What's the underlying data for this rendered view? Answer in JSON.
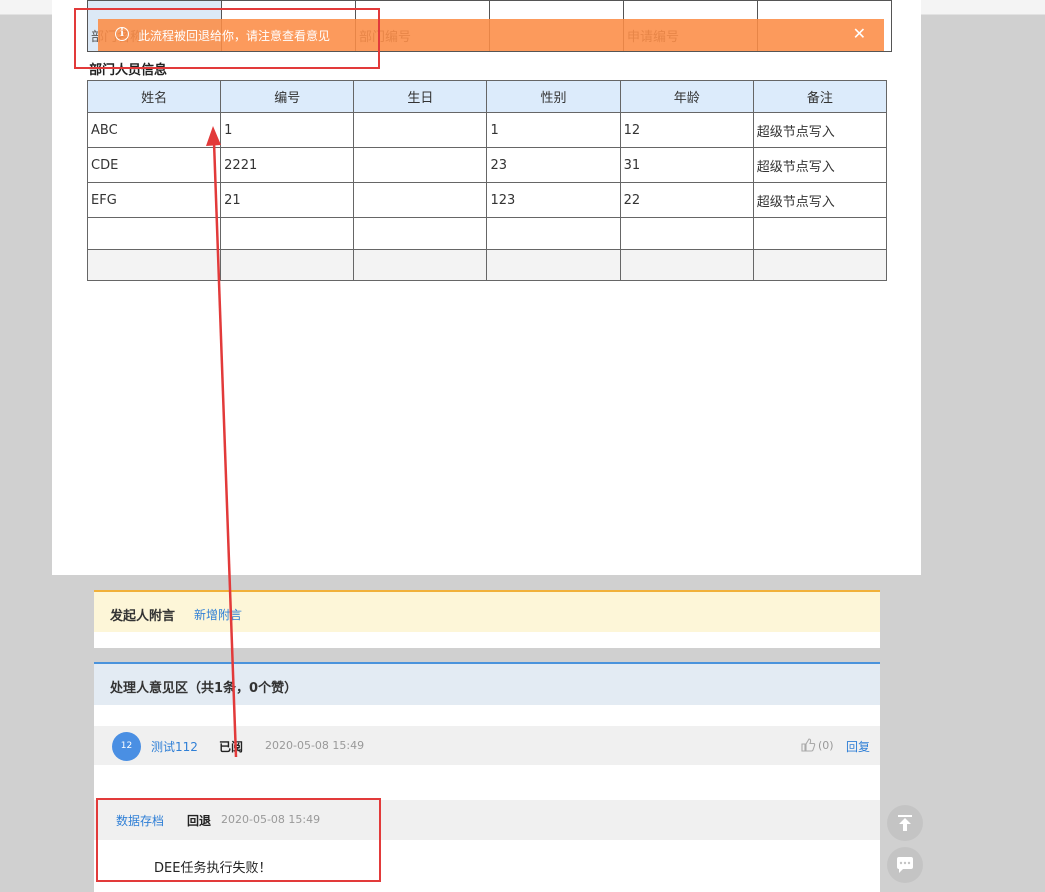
{
  "form": {
    "dept_row": {
      "dept_name_label": "部门名称",
      "dept_code_label": "部门编号",
      "apply_code_label": "申请编号"
    },
    "members_title": "部门人员信息",
    "columns": [
      "姓名",
      "编号",
      "生日",
      "性别",
      "年龄",
      "备注"
    ],
    "rows": [
      [
        "ABC",
        "1",
        "",
        "1",
        "12",
        "超级节点写入"
      ],
      [
        "CDE",
        "2221",
        "",
        "23",
        "31",
        "超级节点写入"
      ],
      [
        "EFG",
        "21",
        "",
        "123",
        "22",
        "超级节点写入"
      ]
    ]
  },
  "alert": {
    "icon": "info-icon",
    "icon_glyph": "i",
    "message": "此流程被回退给你，请注意查看意见",
    "close_glyph": "✕"
  },
  "attachment": {
    "title": "发起人附言",
    "add_link": "新增附言"
  },
  "opinions": {
    "title": "处理人意见区（共1条，0个赞）",
    "items": [
      {
        "avatar_text": "12",
        "user": "测试112",
        "action": "已阅",
        "time": "2020-05-08 15:49",
        "likes": "(0)",
        "reply_label": "回复"
      }
    ]
  },
  "log": {
    "user": "数据存档",
    "action": "回退",
    "time": "2020-05-08 15:49",
    "message": "DEE任务执行失败！"
  },
  "float_buttons": {
    "top_icon": "back-to-top-icon",
    "chat_icon": "chat-bubble-icon"
  },
  "colors": {
    "alert_bg": "#fc8c46",
    "annotation": "#e23a3a",
    "link": "#2f7fd6",
    "header_blue": "#dcebfb"
  }
}
